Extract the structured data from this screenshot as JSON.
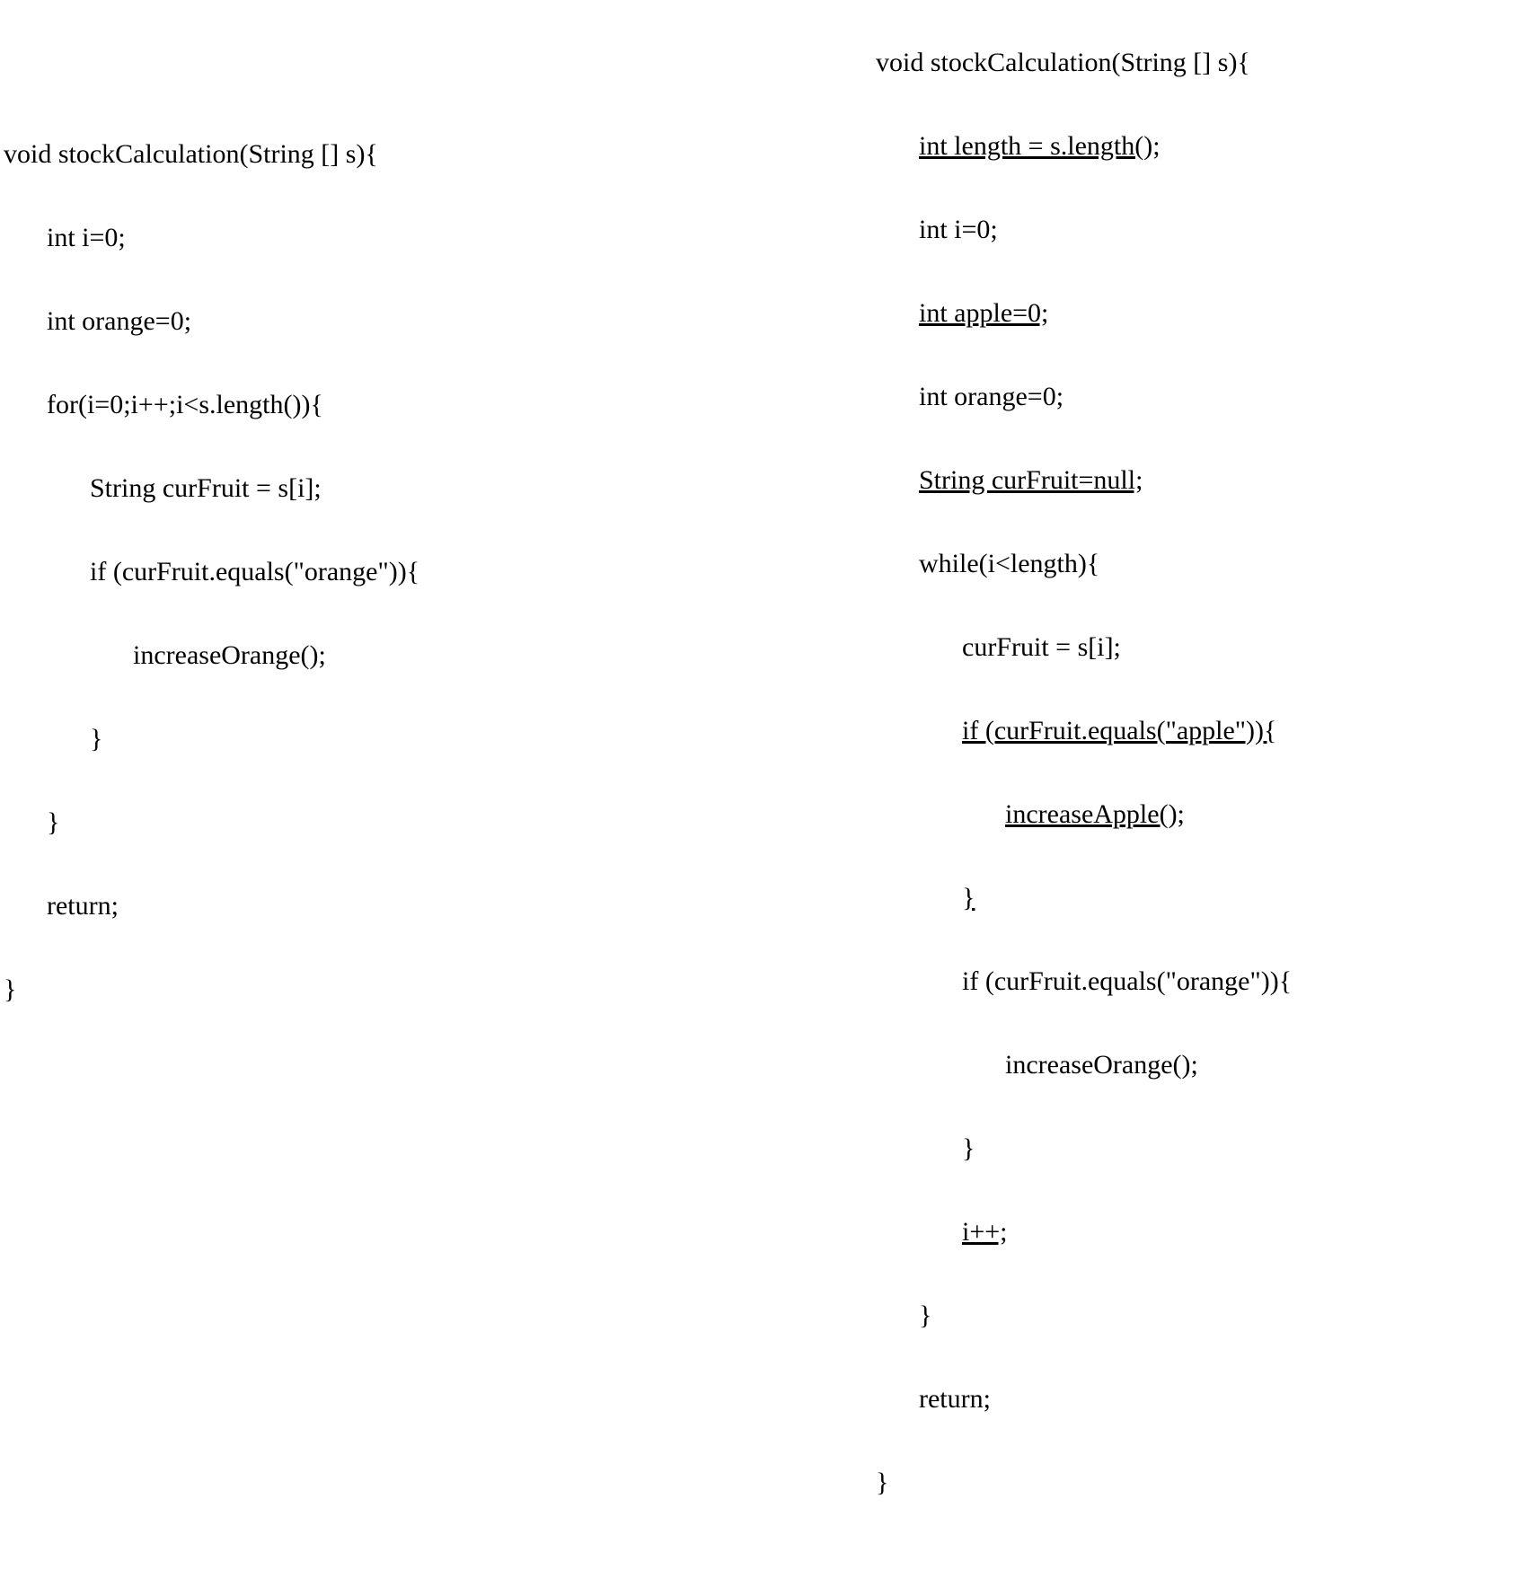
{
  "left": {
    "l1": "void stockCalculation(String [] s){",
    "l2": "int i=0;",
    "l3": "int orange=0;",
    "l4": "for(i=0;i++;i<s.length()){",
    "l5": "String curFruit = s[i];",
    "l6": "if (curFruit.equals(\"orange\")){",
    "l7": "increaseOrange();",
    "l8": "}",
    "l9": "}",
    "l10": "return;",
    "l11": "}"
  },
  "right": {
    "r1": "void stockCalculation(String [] s){",
    "r2": "int length = s.length();",
    "r3": "int i=0;",
    "r4": "int apple=0;",
    "r5": "int orange=0;",
    "r6": "String curFruit=null;",
    "r7": "while(i<length){",
    "r8": "curFruit = s[i];",
    "r9": "if (curFruit.equals(\"apple\")){",
    "r10": "increaseApple();",
    "r11": "}",
    "r12": "if (curFruit.equals(\"orange\")){",
    "r13": "increaseOrange();",
    "r14": "}",
    "r15": "i++;",
    "r16": "}",
    "r17": "return;",
    "r18": "}"
  }
}
